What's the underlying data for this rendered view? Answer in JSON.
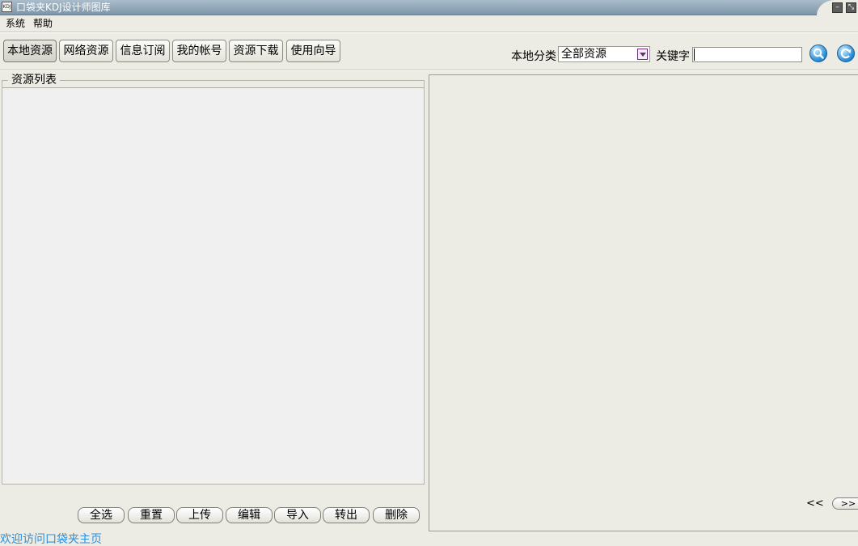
{
  "window": {
    "title": "口袋夹KDJ设计师图库",
    "icon_label": "KDJ"
  },
  "menu": [
    "系统",
    "帮助"
  ],
  "tabs": [
    "本地资源",
    "网络资源",
    "信息订阅",
    "我的帐号",
    "资源下载",
    "使用向导"
  ],
  "active_tab": "本地资源",
  "filter": {
    "category_label": "本地分类",
    "category_value": "全部资源",
    "keyword_label": "关键字",
    "keyword_value": ""
  },
  "icons": {
    "search": "search-icon",
    "refresh": "refresh-icon"
  },
  "resource_list": {
    "title": "资源列表",
    "items": []
  },
  "actions": [
    "全选",
    "重置",
    "上传",
    "编辑",
    "导入",
    "转出",
    "删除"
  ],
  "pager": {
    "prev": "<<",
    "next": ">>"
  },
  "status": {
    "link": "欢迎访问口袋夹主页"
  },
  "colors": {
    "titlebar": "#8ea3b4",
    "background": "#ecebe4",
    "list_bg": "#f0f0f0",
    "link": "#2f8fd8",
    "accent_icon": "#2e8fd6",
    "dropdown_arrow": "#6c2a78"
  }
}
